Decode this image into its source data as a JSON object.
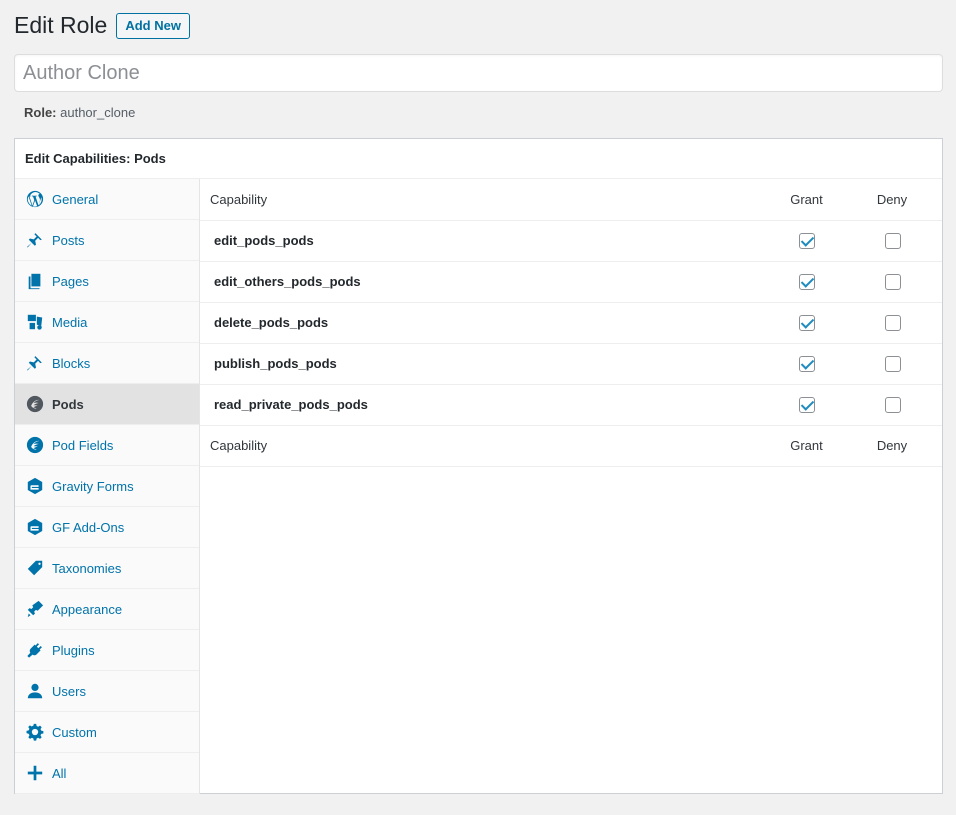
{
  "header": {
    "title": "Edit Role",
    "add_new_label": "Add New"
  },
  "role_name_input": {
    "value": "Author Clone",
    "placeholder": "Author Clone"
  },
  "role_line": {
    "label": "Role:",
    "value": "author_clone"
  },
  "capabilities_box": {
    "title": "Edit Capabilities: Pods"
  },
  "sidebar": {
    "items": [
      {
        "label": "General",
        "icon": "wordpress-icon"
      },
      {
        "label": "Posts",
        "icon": "pushpin-icon"
      },
      {
        "label": "Pages",
        "icon": "pages-icon"
      },
      {
        "label": "Media",
        "icon": "media-icon"
      },
      {
        "label": "Blocks",
        "icon": "pushpin-icon"
      },
      {
        "label": "Pods",
        "icon": "pods-icon",
        "active": true
      },
      {
        "label": "Pod Fields",
        "icon": "pods-icon"
      },
      {
        "label": "Gravity Forms",
        "icon": "gravity-forms-icon"
      },
      {
        "label": "GF Add-Ons",
        "icon": "gravity-forms-icon"
      },
      {
        "label": "Taxonomies",
        "icon": "tag-icon"
      },
      {
        "label": "Appearance",
        "icon": "paintbrush-icon"
      },
      {
        "label": "Plugins",
        "icon": "plugin-icon"
      },
      {
        "label": "Users",
        "icon": "user-icon"
      },
      {
        "label": "Custom",
        "icon": "gear-icon"
      },
      {
        "label": "All",
        "icon": "plus-icon"
      }
    ]
  },
  "table": {
    "columns": {
      "capability": "Capability",
      "grant": "Grant",
      "deny": "Deny"
    },
    "rows": [
      {
        "name": "edit_pods_pods",
        "grant": true,
        "deny": false
      },
      {
        "name": "edit_others_pods_pods",
        "grant": true,
        "deny": false
      },
      {
        "name": "delete_pods_pods",
        "grant": true,
        "deny": false
      },
      {
        "name": "publish_pods_pods",
        "grant": true,
        "deny": false
      },
      {
        "name": "read_private_pods_pods",
        "grant": true,
        "deny": false
      }
    ]
  },
  "colors": {
    "link": "#0073aa",
    "checkmark": "#1e8cbe",
    "active_bg": "#e2e2e2"
  }
}
